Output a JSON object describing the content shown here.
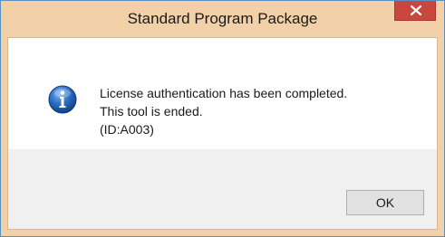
{
  "window": {
    "title": "Standard Program Package"
  },
  "message": {
    "line1": "License authentication has been completed.",
    "line2": "This tool is ended.",
    "line3": "(ID:A003)"
  },
  "icon": {
    "name": "info-icon",
    "color": "#1c5fb8"
  },
  "buttons": {
    "ok_label": "OK"
  },
  "colors": {
    "titlebar": "#f3d1a8",
    "close_button": "#c9473c",
    "footer": "#f0f0f0"
  }
}
